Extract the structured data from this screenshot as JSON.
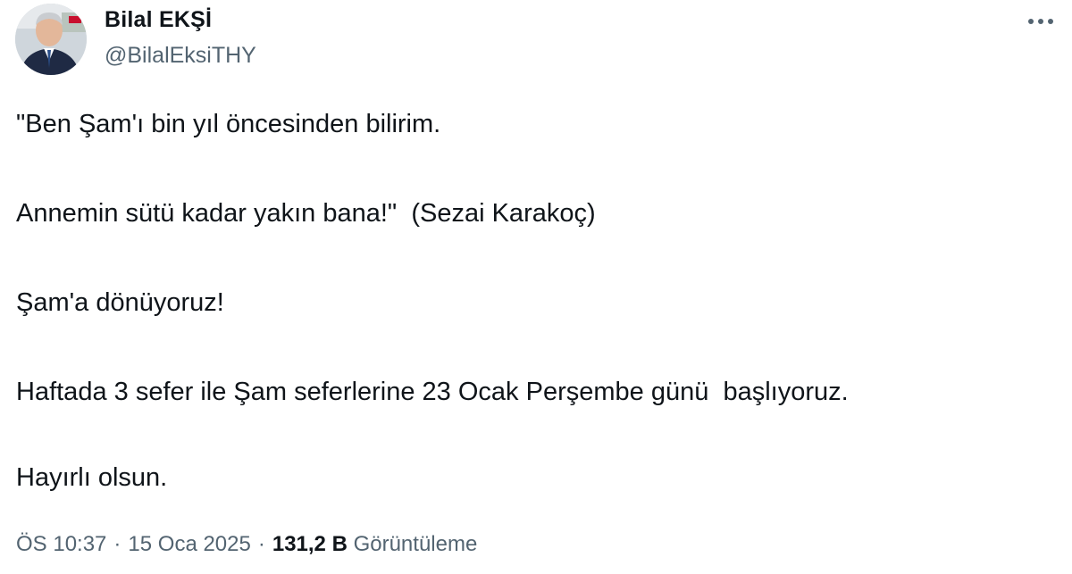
{
  "author": {
    "display_name": "Bilal EKŞİ",
    "handle": "@BilalEksiTHY",
    "avatar_icon": "profile-photo"
  },
  "more_icon": "ellipsis-icon",
  "tweet": {
    "lines": [
      "\"Ben Şam'ı bin yıl öncesinden bilirim.",
      "Annemin sütü kadar yakın bana!\"  (Sezai Karakoç)",
      "Şam'a dönüyoruz!",
      "Haftada 3 sefer ile Şam seferlerine 23 Ocak Perşembe günü  başlıyoruz.",
      "Hayırlı olsun."
    ]
  },
  "meta": {
    "time": "ÖS 10:37",
    "separator": "·",
    "date": "15 Oca 2025",
    "views_count": "131,2 B",
    "views_label": "Görüntüleme"
  },
  "colors": {
    "text": "#0f1419",
    "secondary": "#536471",
    "background": "#ffffff"
  }
}
